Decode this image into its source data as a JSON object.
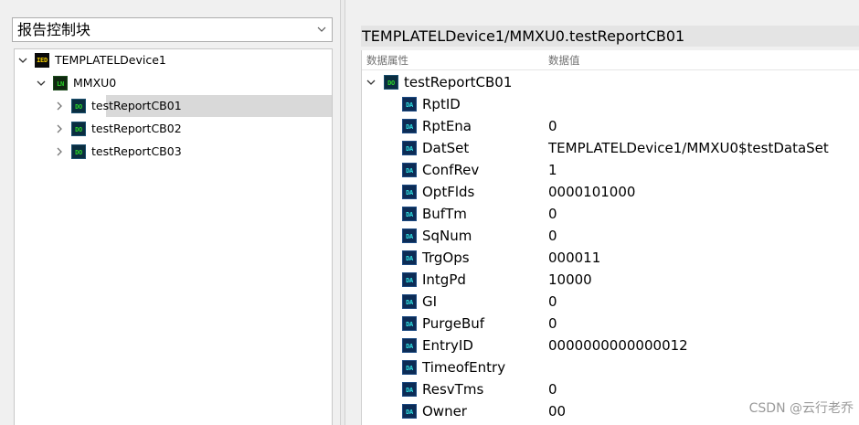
{
  "left_panel": {
    "combo": {
      "selected": "报告控制块"
    },
    "tree": [
      {
        "label": "TEMPLATELDevice1",
        "icon": "IED",
        "icon_name": "ied-icon",
        "expanded": true,
        "selected": false
      },
      {
        "label": "MMXU0",
        "icon": "LN",
        "icon_name": "ln-icon",
        "expanded": true,
        "selected": false
      },
      {
        "label": "testReportCB01",
        "icon": "DO",
        "icon_name": "do-icon",
        "expanded": false,
        "selected": true
      },
      {
        "label": "testReportCB02",
        "icon": "DO",
        "icon_name": "do-icon",
        "expanded": false,
        "selected": false
      },
      {
        "label": "testReportCB03",
        "icon": "DO",
        "icon_name": "do-icon",
        "expanded": false,
        "selected": false
      }
    ]
  },
  "right_panel": {
    "path": "TEMPLATELDevice1/MMXU0.testReportCB01",
    "headers": {
      "name": "数据属性",
      "value": "数据值"
    },
    "root": {
      "label": "testReportCB01",
      "icon": "DO"
    },
    "rows": [
      {
        "name": "RptID",
        "value": "",
        "icon": "DA"
      },
      {
        "name": "RptEna",
        "value": "0",
        "icon": "DA"
      },
      {
        "name": "DatSet",
        "value": "TEMPLATELDevice1/MMXU0$testDataSet",
        "icon": "DA"
      },
      {
        "name": "ConfRev",
        "value": "1",
        "icon": "DA"
      },
      {
        "name": "OptFlds",
        "value": "0000101000",
        "icon": "DA"
      },
      {
        "name": "BufTm",
        "value": "0",
        "icon": "DA"
      },
      {
        "name": "SqNum",
        "value": "0",
        "icon": "DA"
      },
      {
        "name": "TrgOps",
        "value": "000011",
        "icon": "DA"
      },
      {
        "name": "IntgPd",
        "value": "10000",
        "icon": "DA"
      },
      {
        "name": "GI",
        "value": "0",
        "icon": "DA"
      },
      {
        "name": "PurgeBuf",
        "value": "0",
        "icon": "DA"
      },
      {
        "name": "EntryID",
        "value": "0000000000000012",
        "icon": "DA"
      },
      {
        "name": "TimeofEntry",
        "value": "",
        "icon": "DA"
      },
      {
        "name": "ResvTms",
        "value": "0",
        "icon": "DA"
      },
      {
        "name": "Owner",
        "value": "00",
        "icon": "DA"
      }
    ]
  },
  "watermark": "CSDN @云行老乔",
  "colors": {
    "selected_row": "#d9d9d9",
    "ied_icon_text": "#f5d000",
    "do_ln_icon_text": "#28d428",
    "da_icon_text": "#2fe0e0"
  }
}
